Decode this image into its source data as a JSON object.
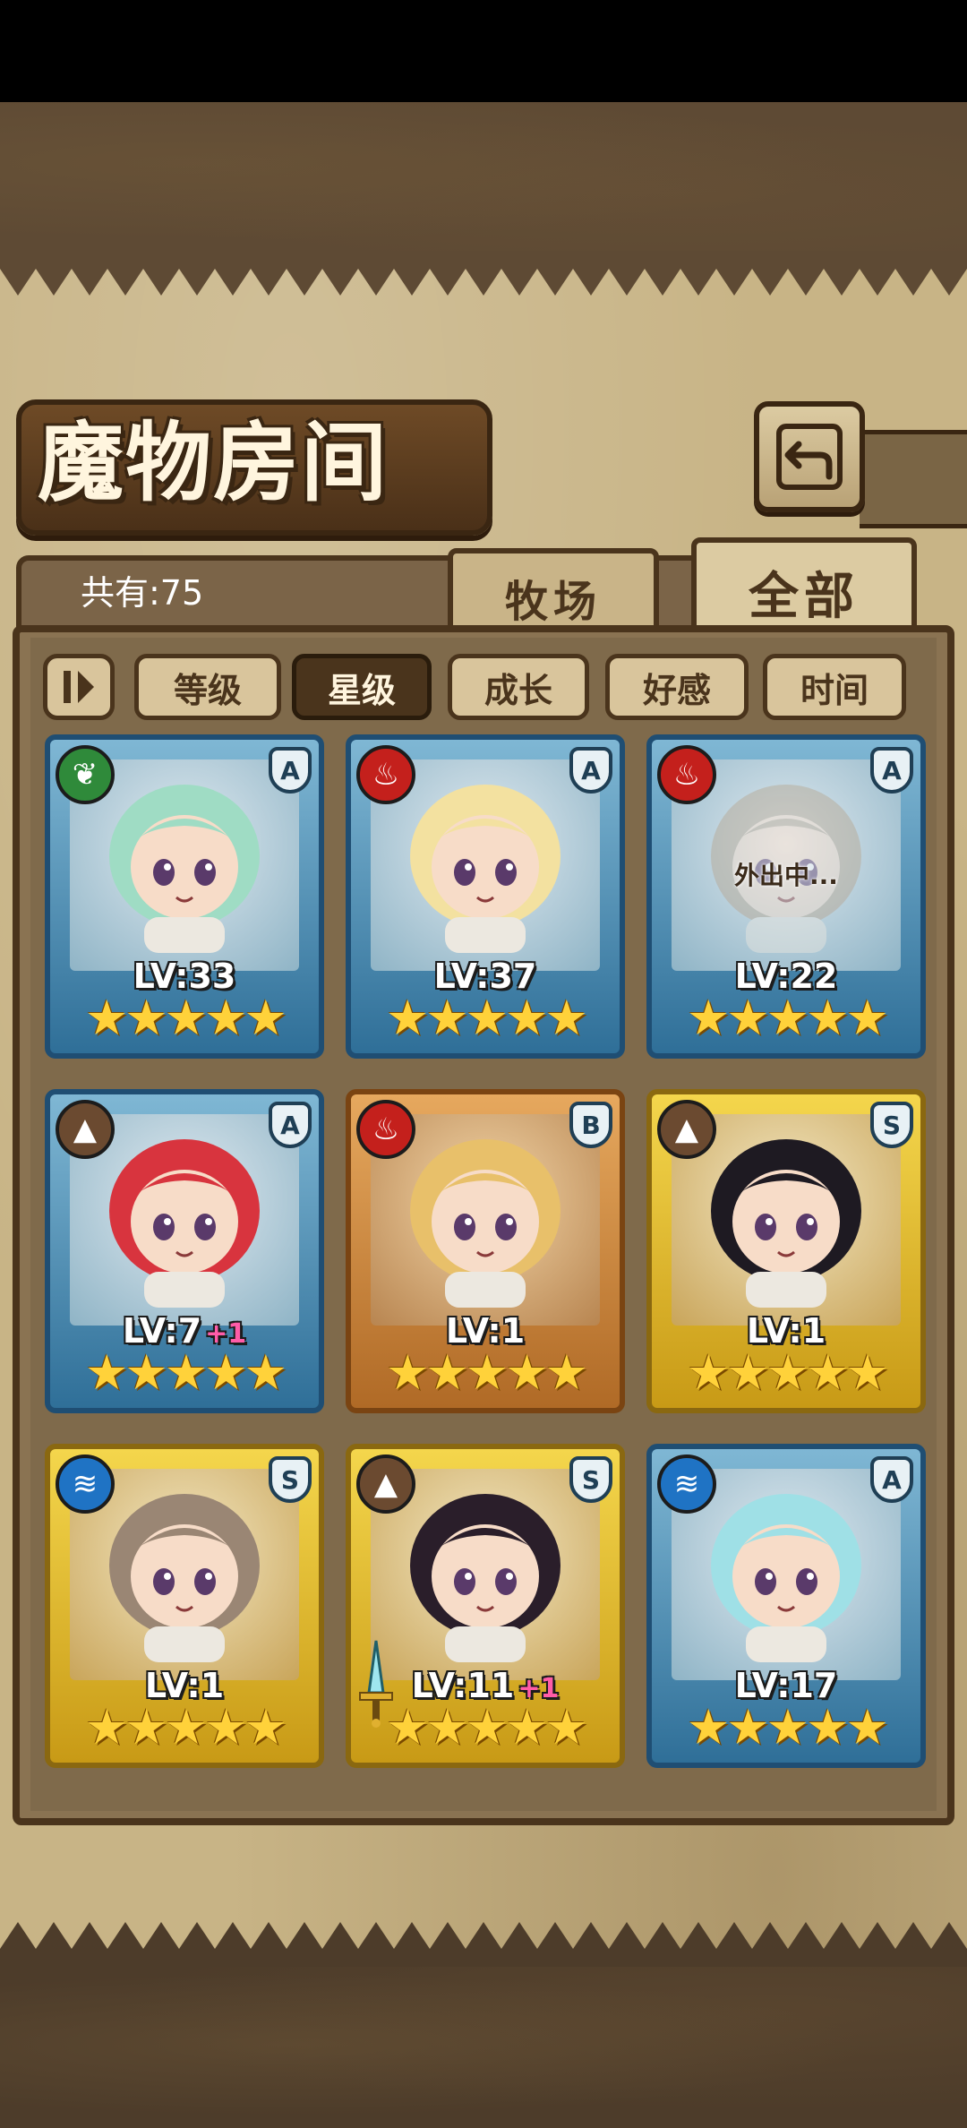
{
  "header": {
    "title": "魔物房间"
  },
  "summary": {
    "count_text": "共有:75"
  },
  "tabs": [
    {
      "label": "牧场",
      "active": false
    },
    {
      "label": "全部",
      "active": true
    }
  ],
  "sort_buttons": [
    {
      "label": "等级",
      "active": false
    },
    {
      "label": "星级",
      "active": true
    },
    {
      "label": "成长",
      "active": false
    },
    {
      "label": "好感",
      "active": false
    },
    {
      "label": "时间",
      "active": false
    }
  ],
  "monsters": [
    {
      "element": "wood",
      "element_icon": "leaf-icon",
      "rank": "A",
      "level": "LV:33",
      "bonus": "",
      "stars": 5,
      "frame": "blue",
      "status": "",
      "hair": "#9fdcc4"
    },
    {
      "element": "fire",
      "element_icon": "flame-icon",
      "rank": "A",
      "level": "LV:37",
      "bonus": "",
      "stars": 5,
      "frame": "blue",
      "status": "",
      "hair": "#f3e1a0"
    },
    {
      "element": "fire",
      "element_icon": "flame-icon",
      "rank": "A",
      "level": "LV:22",
      "bonus": "",
      "stars": 5,
      "frame": "blue",
      "status": "外出中...",
      "hair": "#b7a690"
    },
    {
      "element": "earth",
      "element_icon": "mountain-icon",
      "rank": "A",
      "level": "LV:7",
      "bonus": "+1",
      "stars": 5,
      "frame": "blue",
      "status": "",
      "hair": "#d8343e"
    },
    {
      "element": "fire",
      "element_icon": "flame-icon",
      "rank": "B",
      "level": "LV:1",
      "bonus": "",
      "stars": 5,
      "frame": "orange",
      "status": "",
      "hair": "#e8c06a"
    },
    {
      "element": "earth",
      "element_icon": "mountain-icon",
      "rank": "S",
      "level": "LV:1",
      "bonus": "",
      "stars": 5,
      "frame": "gold",
      "status": "",
      "hair": "#1e1a22"
    },
    {
      "element": "water",
      "element_icon": "wave-icon",
      "rank": "S",
      "level": "LV:1",
      "bonus": "",
      "stars": 5,
      "frame": "gold",
      "status": "",
      "hair": "#9a8674"
    },
    {
      "element": "earth",
      "element_icon": "mountain-icon",
      "rank": "S",
      "level": "LV:11",
      "bonus": "+1",
      "stars": 5,
      "frame": "gold",
      "status": "",
      "hair": "#2a1e2a"
    },
    {
      "element": "water",
      "element_icon": "wave-icon",
      "rank": "A",
      "level": "LV:17",
      "bonus": "",
      "stars": 5,
      "frame": "blue",
      "status": "",
      "hair": "#9fe0e6"
    }
  ],
  "colors": {
    "parchment": "#c8b486",
    "frame_dark": "#4a341c",
    "bonus_pink": "#ff5ca8",
    "star_gold": "#ffd23a"
  }
}
